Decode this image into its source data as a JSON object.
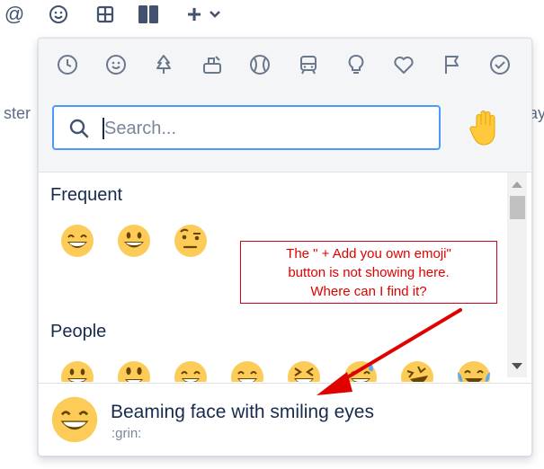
{
  "toolbar": {
    "items": [
      {
        "icon": "at-icon",
        "label": "@"
      },
      {
        "icon": "emoji-icon"
      },
      {
        "icon": "table-icon"
      },
      {
        "icon": "layout-icon"
      },
      {
        "icon": "plus-icon",
        "label": "+"
      },
      {
        "icon": "chevron-down-icon"
      }
    ]
  },
  "background": {
    "left_fragment": "ster",
    "right_fragment": "ay"
  },
  "emoji_picker": {
    "categories": [
      "frequent-clock-icon",
      "people-smiley-icon",
      "nature-tree-icon",
      "foods-icon",
      "activity-ball-icon",
      "travel-train-icon",
      "objects-bulb-icon",
      "symbols-heart-icon",
      "flags-icon",
      "productivity-check-icon"
    ],
    "search": {
      "placeholder": "Search...",
      "value": ""
    },
    "tone_selector": "raised-hand-icon",
    "sections": [
      {
        "title": "Frequent",
        "emojis": [
          "beaming-face",
          "grinning-face",
          "raised-eyebrow-face"
        ]
      },
      {
        "title": "People",
        "emojis": [
          "grinning-face",
          "grinning-big-eyes-face",
          "grinning-smiling-eyes-face",
          "beaming-face",
          "squinting-face",
          "sweat-smile-face",
          "rolling-laughing-face",
          "tears-of-joy-face"
        ]
      }
    ],
    "preview": {
      "emoji": "beaming-face",
      "name": "Beaming face with smiling eyes",
      "shortname": ":grin:"
    }
  },
  "annotation": {
    "line1": "The \" + Add you own emoji\"",
    "line2": "button is not showing here.",
    "line3": "Where can I find it?",
    "color": "#e00000"
  }
}
